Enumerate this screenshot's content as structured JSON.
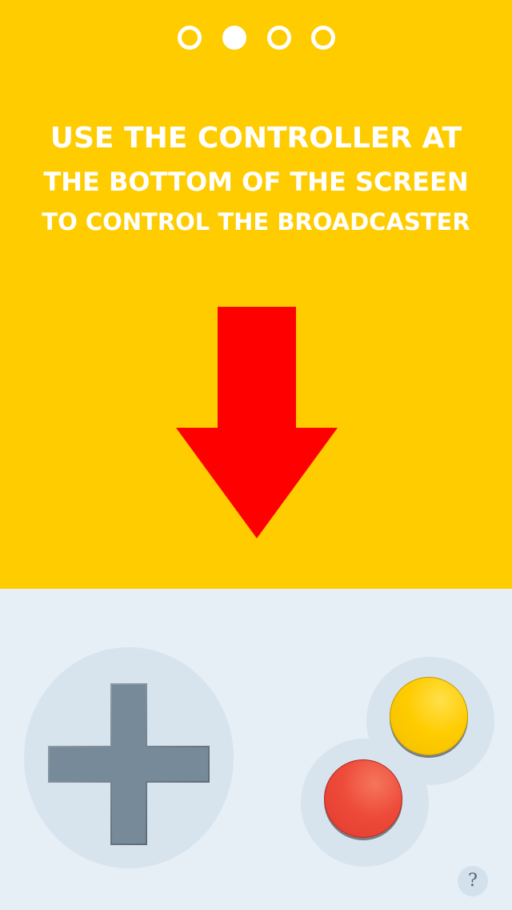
{
  "pagination": {
    "total": 4,
    "active_index": 1
  },
  "instructions": {
    "line1": "USE THE CONTROLLER AT",
    "line2": "THE BOTTOM OF THE SCREEN",
    "line3": "TO CONTROL THE BROADCASTER"
  },
  "icons": {
    "arrow": "down-arrow-icon",
    "dpad": "dpad-icon",
    "help": "question-icon"
  },
  "controller": {
    "help_label": "?"
  },
  "colors": {
    "top_background": "#FFCC00",
    "bottom_background": "#E6EEF6",
    "arrow": "#FF0000",
    "dpad": "#778A99",
    "button_a": "#FFCC00",
    "button_b": "#EE4B3A",
    "text": "#FFFFFF"
  }
}
